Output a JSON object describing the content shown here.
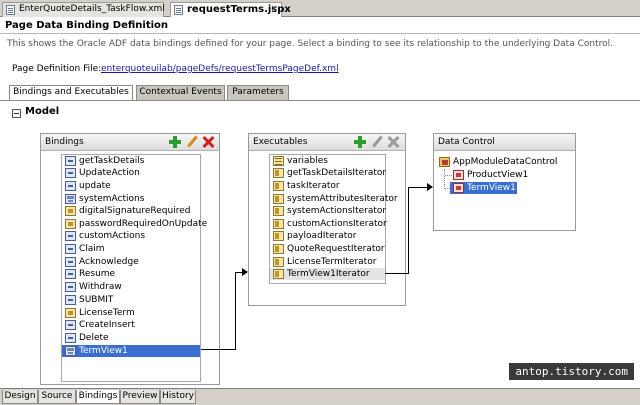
{
  "editor_tabs": [
    {
      "label": "EnterQuoteDetails_TaskFlow.xml",
      "active": false
    },
    {
      "label": "requestTerms.jspx",
      "active": true
    }
  ],
  "page_title": "Page Data Binding Definition",
  "description": "This shows the Oracle ADF data bindings defined for your page. Select a binding to see its relationship to the underlying Data Control.",
  "page_definition": {
    "label": "Page Definition File:",
    "link": "enterquoteuilab/pageDefs/requestTermsPageDef.xml"
  },
  "panel_tabs": [
    {
      "label": "Bindings and Executables",
      "active": true
    },
    {
      "label": "Contextual Events",
      "active": false
    },
    {
      "label": "Parameters",
      "active": false
    }
  ],
  "model_label": "Model",
  "bindings_panel": {
    "title": "Bindings",
    "items": [
      {
        "label": "getTaskDetails",
        "icon": "method-icon"
      },
      {
        "label": "UpdateAction",
        "icon": "method-icon"
      },
      {
        "label": "update",
        "icon": "method-icon"
      },
      {
        "label": "systemActions",
        "icon": "tree-binding-icon"
      },
      {
        "label": "digitalSignatureRequired",
        "icon": "attribute-icon"
      },
      {
        "label": "passwordRequiredOnUpdate",
        "icon": "attribute-icon"
      },
      {
        "label": "customActions",
        "icon": "method-icon"
      },
      {
        "label": "Claim",
        "icon": "method-icon"
      },
      {
        "label": "Acknowledge",
        "icon": "method-icon"
      },
      {
        "label": "Resume",
        "icon": "method-icon"
      },
      {
        "label": "Withdraw",
        "icon": "method-icon"
      },
      {
        "label": "SUBMIT",
        "icon": "method-icon"
      },
      {
        "label": "LicenseTerm",
        "icon": "attribute-icon"
      },
      {
        "label": "CreateInsert",
        "icon": "method-icon"
      },
      {
        "label": "Delete",
        "icon": "method-icon"
      },
      {
        "label": "TermView1",
        "icon": "tree-binding-icon",
        "selected": true
      }
    ]
  },
  "executables_panel": {
    "title": "Executables",
    "items": [
      {
        "label": "variables",
        "icon": "variables-icon"
      },
      {
        "label": "getTaskDetailsIterator",
        "icon": "iterator-icon"
      },
      {
        "label": "taskIterator",
        "icon": "iterator-icon"
      },
      {
        "label": "systemAttributesIterator",
        "icon": "iterator-icon"
      },
      {
        "label": "systemActionsIterator",
        "icon": "iterator-icon"
      },
      {
        "label": "customActionsIterator",
        "icon": "iterator-icon"
      },
      {
        "label": "payloadIterator",
        "icon": "iterator-icon"
      },
      {
        "label": "QuoteRequestIterator",
        "icon": "iterator-icon"
      },
      {
        "label": "LicenseTermIterator",
        "icon": "iterator-icon"
      },
      {
        "label": "TermView1Iterator",
        "icon": "iterator-icon",
        "highlighted": true
      }
    ]
  },
  "data_control_panel": {
    "title": "Data Control",
    "root": "AppModuleDataControl",
    "children": [
      {
        "label": "ProductView1",
        "selected": false
      },
      {
        "label": "TermView1",
        "selected": true
      }
    ]
  },
  "watermark": "antop.tistory.com",
  "bottom_tabs": [
    {
      "label": "Design",
      "active": false
    },
    {
      "label": "Source",
      "active": false
    },
    {
      "label": "Bindings",
      "active": true
    },
    {
      "label": "Preview",
      "active": false
    },
    {
      "label": "History",
      "active": false
    }
  ],
  "colors": {
    "selection": "#3a6fd0",
    "link": "#1a1aa8",
    "add": "#2e9b2e",
    "delete": "#d02020"
  }
}
